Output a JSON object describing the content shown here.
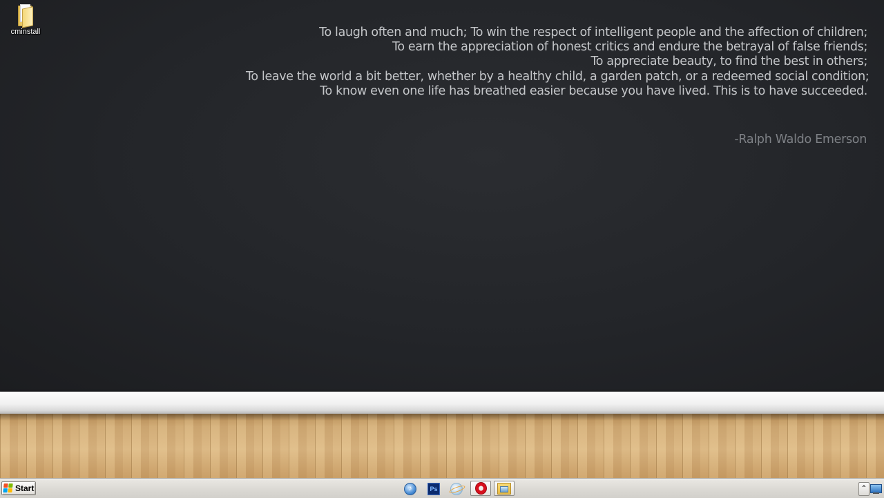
{
  "desktop": {
    "icons": [
      {
        "label": "cminstall",
        "icon": "folder-icon"
      }
    ]
  },
  "wallpaper": {
    "quote_lines": [
      "To laugh often and much; To win the respect of intelligent people and the affection of children;",
      "To earn the appreciation of honest critics and endure the betrayal of false friends;",
      "To appreciate beauty, to find the best in others;",
      "To leave the world a bit better, whether by a healthy child, a garden patch, or a redeemed social condition;",
      "To know even one life has breathed easier because you have lived. This is to have succeeded."
    ],
    "author": "-Ralph Waldo Emerson",
    "colors": {
      "wall": "#232529",
      "quote_text": "#c4c6c9",
      "author_text": "#7d8085",
      "floor": "#d2ad78"
    }
  },
  "taskbar": {
    "start_label": "Start",
    "quicklaunch": [
      {
        "name": "itunes-icon",
        "glyph": "♪"
      },
      {
        "name": "photoshop-icon",
        "glyph": "Ps"
      },
      {
        "name": "globe-icon",
        "glyph": ""
      }
    ],
    "open_apps": [
      {
        "name": "opera-icon"
      },
      {
        "name": "windows-explorer-icon"
      }
    ],
    "tray": {
      "expand_glyph": "⌃"
    }
  }
}
